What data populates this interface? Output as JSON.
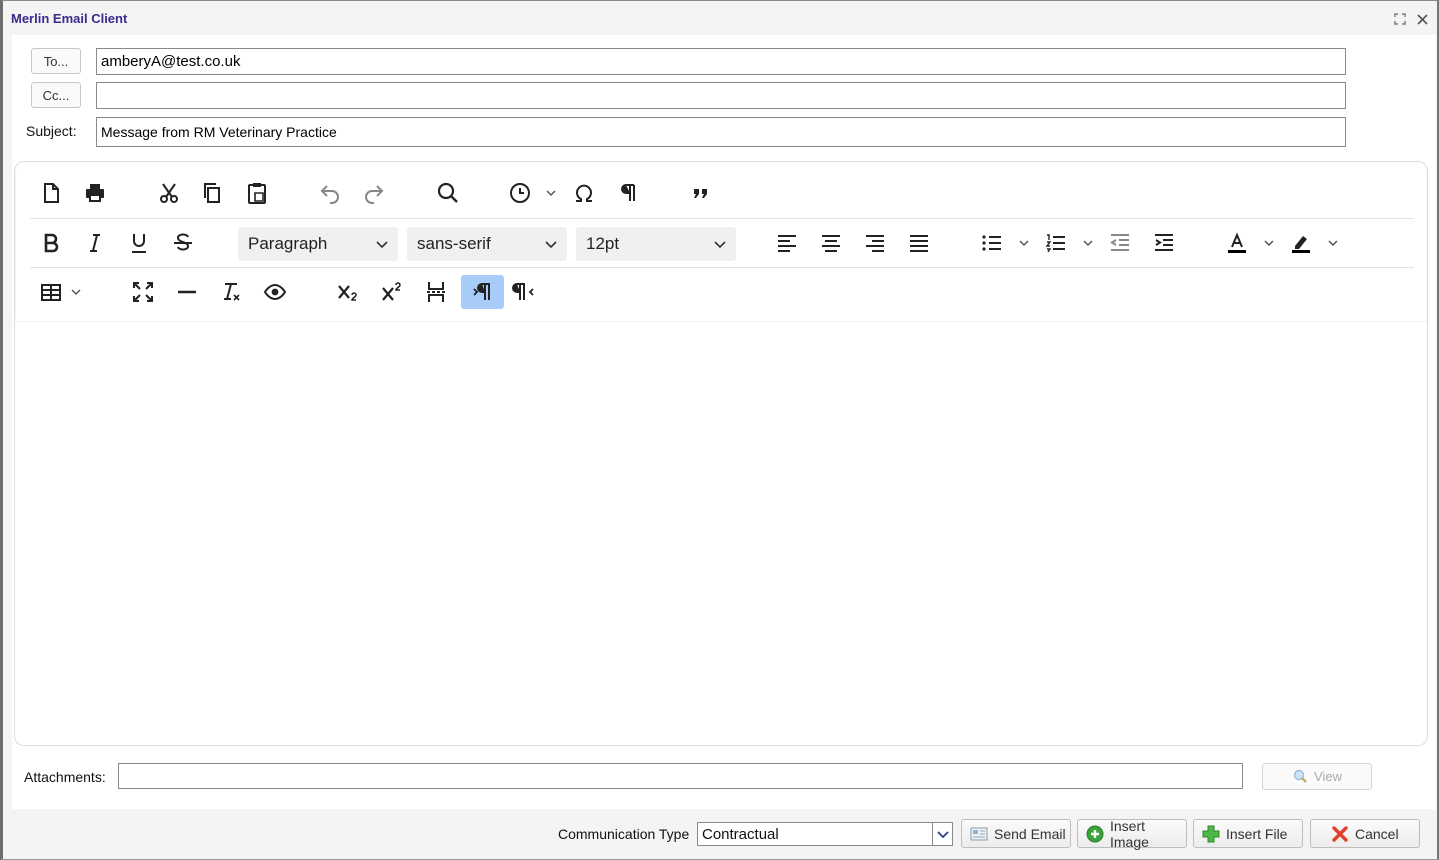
{
  "window": {
    "title": "Merlin Email Client"
  },
  "header": {
    "to_button": "To...",
    "cc_button": "Cc...",
    "subject_label": "Subject:",
    "to_value": "amberyA@test.co.uk",
    "cc_value": "",
    "subject_value": "Message from RM Veterinary Practice"
  },
  "toolbar": {
    "block_format": "Paragraph",
    "font_family": "sans-serif",
    "font_size": "12pt",
    "icons": [
      "new-document-icon",
      "print-icon",
      "cut-icon",
      "copy-icon",
      "paste-icon",
      "undo-icon",
      "redo-icon",
      "find-icon",
      "insert-datetime-icon",
      "special-character-icon",
      "show-blocks-icon",
      "blockquote-icon",
      "bold-icon",
      "italic-icon",
      "underline-icon",
      "strikethrough-icon",
      "align-left-icon",
      "align-center-icon",
      "align-right-icon",
      "align-justify-icon",
      "bullet-list-icon",
      "numbered-list-icon",
      "outdent-icon",
      "indent-icon",
      "text-color-icon",
      "highlight-color-icon",
      "table-icon",
      "fullscreen-icon",
      "horizontal-rule-icon",
      "clear-formatting-icon",
      "preview-icon",
      "subscript-icon",
      "superscript-icon",
      "page-break-icon",
      "ltr-icon",
      "rtl-icon"
    ],
    "ltr_active": true
  },
  "attachments": {
    "label": "Attachments:",
    "value": "",
    "view_button": "View"
  },
  "footer": {
    "communication_type_label": "Communication Type",
    "communication_type_value": "Contractual",
    "send_email": "Send Email",
    "insert_image": "Insert Image",
    "insert_file": "Insert File",
    "cancel": "Cancel"
  },
  "colors": {
    "title": "#3b2a8c",
    "active_button": "#a6ccf7",
    "cancel_icon": "#e0402a",
    "add_icon": "#3aa33a"
  }
}
